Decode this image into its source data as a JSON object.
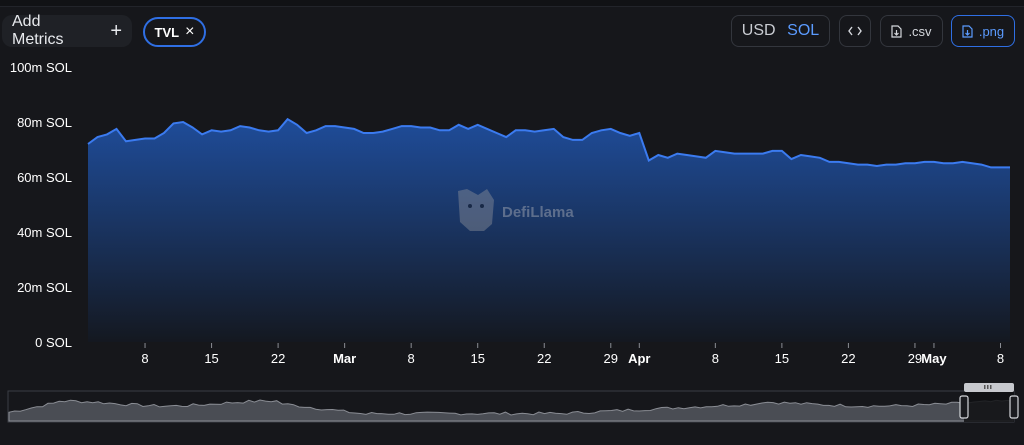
{
  "toolbar": {
    "add_metrics_label": "Add Metrics",
    "add_icon": "plus-icon",
    "metric_pill_label": "TVL",
    "remove_icon": "close-icon",
    "currency_usd": "USD",
    "currency_sol": "SOL",
    "currency_selected": "SOL",
    "embed_icon": "code-icon",
    "csv_label": ".csv",
    "png_label": ".png",
    "file_icon": "file-download-icon"
  },
  "colors": {
    "background": "#16171b",
    "line": "#3b7bf0",
    "area_top": "#1f4fa0",
    "area_bottom": "#141820",
    "accent": "#2f6fe4"
  },
  "watermark": "DefiLlama",
  "chart_data": {
    "type": "area",
    "title": "",
    "xlabel": "",
    "ylabel": "",
    "ylim": [
      0,
      100
    ],
    "y_unit": "m SOL",
    "y_ticks": [
      "0 SOL",
      "20m SOL",
      "40m SOL",
      "60m SOL",
      "80m SOL",
      "100m SOL"
    ],
    "x_ticks": [
      {
        "label": "8",
        "day": 8,
        "month": false
      },
      {
        "label": "15",
        "day": 15,
        "month": false
      },
      {
        "label": "22",
        "day": 22,
        "month": false
      },
      {
        "label": "Mar",
        "day": 29,
        "month": true
      },
      {
        "label": "8",
        "day": 36,
        "month": false
      },
      {
        "label": "15",
        "day": 43,
        "month": false
      },
      {
        "label": "22",
        "day": 50,
        "month": false
      },
      {
        "label": "29",
        "day": 57,
        "month": false
      },
      {
        "label": "Apr",
        "day": 60,
        "month": true
      },
      {
        "label": "8",
        "day": 68,
        "month": false
      },
      {
        "label": "15",
        "day": 75,
        "month": false
      },
      {
        "label": "22",
        "day": 82,
        "month": false
      },
      {
        "label": "29",
        "day": 89,
        "month": false
      },
      {
        "label": "May",
        "day": 91,
        "month": true
      },
      {
        "label": "8",
        "day": 98,
        "month": false
      }
    ],
    "x_start_day": 2,
    "x_end_day": 99,
    "series": [
      {
        "values": [
          [
            2,
            72
          ],
          [
            3,
            74.5
          ],
          [
            4,
            75.5
          ],
          [
            5,
            77.5
          ],
          [
            6,
            73
          ],
          [
            7,
            73.5
          ],
          [
            8,
            74
          ],
          [
            9,
            74
          ],
          [
            10,
            76
          ],
          [
            11,
            79.5
          ],
          [
            12,
            80
          ],
          [
            13,
            78
          ],
          [
            14,
            75.5
          ],
          [
            15,
            77
          ],
          [
            16,
            76.5
          ],
          [
            17,
            77
          ],
          [
            18,
            78.5
          ],
          [
            19,
            78
          ],
          [
            20,
            77
          ],
          [
            21,
            76.5
          ],
          [
            22,
            77
          ],
          [
            23,
            81
          ],
          [
            24,
            79
          ],
          [
            25,
            76
          ],
          [
            26,
            77
          ],
          [
            27,
            78.5
          ],
          [
            28,
            78.5
          ],
          [
            29,
            78
          ],
          [
            30,
            77.5
          ],
          [
            31,
            76
          ],
          [
            32,
            76
          ],
          [
            33,
            76.5
          ],
          [
            34,
            77.5
          ],
          [
            35,
            78.5
          ],
          [
            36,
            78.5
          ],
          [
            37,
            78
          ],
          [
            38,
            78
          ],
          [
            39,
            77
          ],
          [
            40,
            77
          ],
          [
            41,
            79
          ],
          [
            42,
            77.5
          ],
          [
            43,
            79
          ],
          [
            44,
            77.5
          ],
          [
            45,
            76
          ],
          [
            46,
            74.5
          ],
          [
            47,
            77
          ],
          [
            48,
            77
          ],
          [
            49,
            76.5
          ],
          [
            50,
            77
          ],
          [
            51,
            77.5
          ],
          [
            52,
            74.5
          ],
          [
            53,
            73.5
          ],
          [
            54,
            73.5
          ],
          [
            55,
            76
          ],
          [
            56,
            77
          ],
          [
            57,
            77.5
          ],
          [
            58,
            76
          ],
          [
            59,
            75
          ],
          [
            60,
            76
          ],
          [
            61,
            66
          ],
          [
            62,
            68
          ],
          [
            63,
            67
          ],
          [
            64,
            68.5
          ],
          [
            65,
            68
          ],
          [
            66,
            67.5
          ],
          [
            67,
            67
          ],
          [
            68,
            69.5
          ],
          [
            69,
            69
          ],
          [
            70,
            68.5
          ],
          [
            71,
            68.5
          ],
          [
            72,
            68.5
          ],
          [
            73,
            68.5
          ],
          [
            74,
            69.5
          ],
          [
            75,
            69.5
          ],
          [
            76,
            66.5
          ],
          [
            77,
            68
          ],
          [
            78,
            67.5
          ],
          [
            79,
            67
          ],
          [
            80,
            65.5
          ],
          [
            81,
            65.5
          ],
          [
            82,
            65
          ],
          [
            83,
            64.5
          ],
          [
            84,
            64.5
          ],
          [
            85,
            64
          ],
          [
            86,
            64.5
          ],
          [
            87,
            64.5
          ],
          [
            88,
            65
          ],
          [
            89,
            65
          ],
          [
            90,
            65.5
          ],
          [
            91,
            65.5
          ],
          [
            92,
            65
          ],
          [
            93,
            65
          ],
          [
            94,
            65.5
          ],
          [
            95,
            65
          ],
          [
            96,
            64.5
          ],
          [
            97,
            63.5
          ],
          [
            98,
            63.5
          ],
          [
            99,
            63.5
          ]
        ]
      }
    ]
  }
}
